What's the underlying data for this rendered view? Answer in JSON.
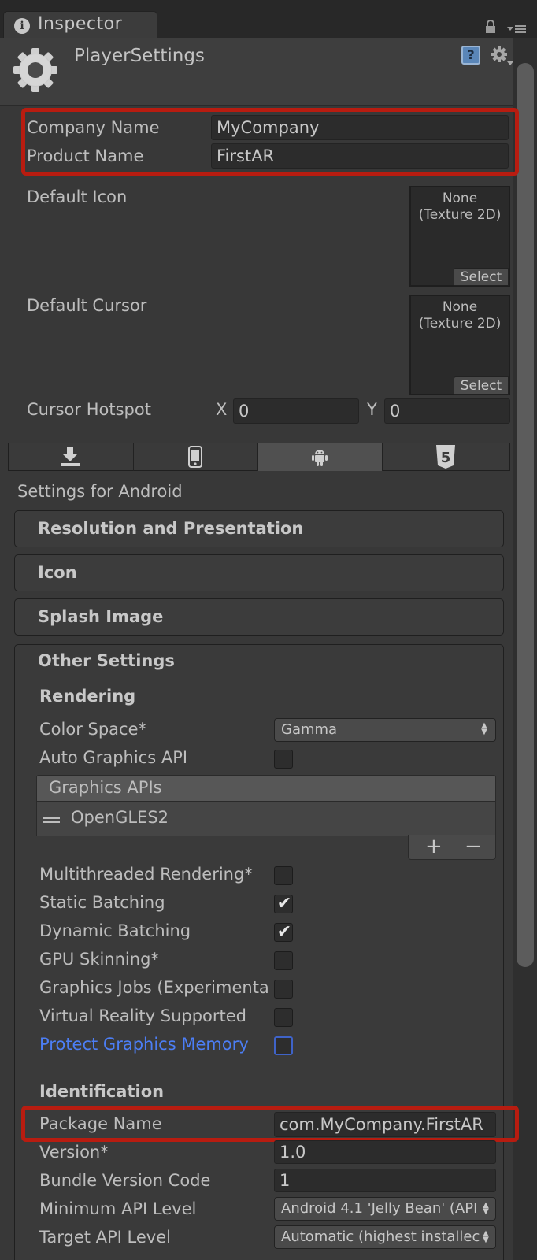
{
  "window": {
    "tab_title": "Inspector",
    "header_title": "PlayerSettings",
    "help_glyph": "?"
  },
  "fields": {
    "company_label": "Company Name",
    "company_value": "MyCompany",
    "product_label": "Product Name",
    "product_value": "FirstAR",
    "default_icon_label": "Default Icon",
    "default_cursor_label": "Default Cursor",
    "texture_none": "None",
    "texture_type": "(Texture 2D)",
    "select_label": "Select",
    "cursor_hotspot_label": "Cursor Hotspot",
    "x_label": "X",
    "x_value": "0",
    "y_label": "Y",
    "y_value": "0"
  },
  "platforms": {
    "icons": [
      "download-icon",
      "phone-icon",
      "android-icon",
      "html5-icon"
    ],
    "active_index": 2,
    "html5_glyph": "5",
    "settings_for": "Settings for Android"
  },
  "sections": {
    "resolution": "Resolution and Presentation",
    "icon": "Icon",
    "splash": "Splash Image",
    "other": "Other Settings"
  },
  "rendering": {
    "heading": "Rendering",
    "color_space_label": "Color Space*",
    "color_space_value": "Gamma",
    "auto_graphics_label": "Auto Graphics API",
    "auto_graphics_checked": false,
    "graphics_apis_heading": "Graphics APIs",
    "graphics_api_item": "OpenGLES2",
    "add_glyph": "+",
    "remove_glyph": "−",
    "options": [
      {
        "label": "Multithreaded Rendering*",
        "checked": false
      },
      {
        "label": "Static Batching",
        "checked": true
      },
      {
        "label": "Dynamic Batching",
        "checked": true
      },
      {
        "label": "GPU Skinning*",
        "checked": false
      },
      {
        "label": "Graphics Jobs (Experimenta",
        "checked": false
      },
      {
        "label": "Virtual Reality Supported",
        "checked": false
      },
      {
        "label": "Protect Graphics Memory",
        "checked": false
      }
    ],
    "check_glyph": "✔"
  },
  "identification": {
    "heading": "Identification",
    "package_label": "Package Name",
    "package_value": "com.MyCompany.FirstAR",
    "version_label": "Version*",
    "version_value": "1.0",
    "bundle_label": "Bundle Version Code",
    "bundle_value": "1",
    "min_api_label": "Minimum API Level",
    "min_api_value": "Android 4.1 'Jelly Bean' (API",
    "target_api_label": "Target API Level",
    "target_api_value": "Automatic (highest installec"
  },
  "colors": {
    "highlight_red": "#b81c10",
    "link_blue": "#4c7ef5",
    "background": "#383838"
  }
}
